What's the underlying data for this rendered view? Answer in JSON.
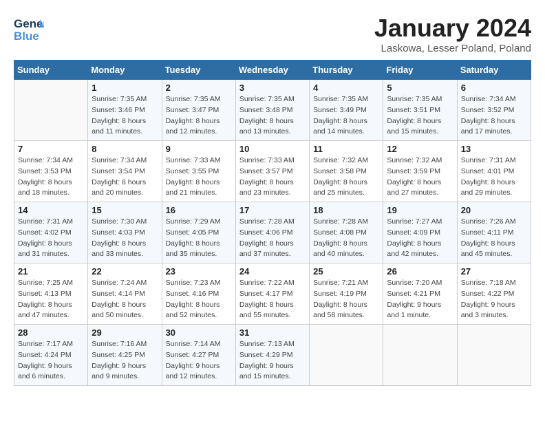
{
  "header": {
    "logo_line1": "General",
    "logo_line2": "Blue",
    "month": "January 2024",
    "location": "Laskowa, Lesser Poland, Poland"
  },
  "weekdays": [
    "Sunday",
    "Monday",
    "Tuesday",
    "Wednesday",
    "Thursday",
    "Friday",
    "Saturday"
  ],
  "weeks": [
    [
      {
        "day": "",
        "sunrise": "",
        "sunset": "",
        "daylight": ""
      },
      {
        "day": "1",
        "sunrise": "Sunrise: 7:35 AM",
        "sunset": "Sunset: 3:46 PM",
        "daylight": "Daylight: 8 hours and 11 minutes."
      },
      {
        "day": "2",
        "sunrise": "Sunrise: 7:35 AM",
        "sunset": "Sunset: 3:47 PM",
        "daylight": "Daylight: 8 hours and 12 minutes."
      },
      {
        "day": "3",
        "sunrise": "Sunrise: 7:35 AM",
        "sunset": "Sunset: 3:48 PM",
        "daylight": "Daylight: 8 hours and 13 minutes."
      },
      {
        "day": "4",
        "sunrise": "Sunrise: 7:35 AM",
        "sunset": "Sunset: 3:49 PM",
        "daylight": "Daylight: 8 hours and 14 minutes."
      },
      {
        "day": "5",
        "sunrise": "Sunrise: 7:35 AM",
        "sunset": "Sunset: 3:51 PM",
        "daylight": "Daylight: 8 hours and 15 minutes."
      },
      {
        "day": "6",
        "sunrise": "Sunrise: 7:34 AM",
        "sunset": "Sunset: 3:52 PM",
        "daylight": "Daylight: 8 hours and 17 minutes."
      }
    ],
    [
      {
        "day": "7",
        "sunrise": "Sunrise: 7:34 AM",
        "sunset": "Sunset: 3:53 PM",
        "daylight": "Daylight: 8 hours and 18 minutes."
      },
      {
        "day": "8",
        "sunrise": "Sunrise: 7:34 AM",
        "sunset": "Sunset: 3:54 PM",
        "daylight": "Daylight: 8 hours and 20 minutes."
      },
      {
        "day": "9",
        "sunrise": "Sunrise: 7:33 AM",
        "sunset": "Sunset: 3:55 PM",
        "daylight": "Daylight: 8 hours and 21 minutes."
      },
      {
        "day": "10",
        "sunrise": "Sunrise: 7:33 AM",
        "sunset": "Sunset: 3:57 PM",
        "daylight": "Daylight: 8 hours and 23 minutes."
      },
      {
        "day": "11",
        "sunrise": "Sunrise: 7:32 AM",
        "sunset": "Sunset: 3:58 PM",
        "daylight": "Daylight: 8 hours and 25 minutes."
      },
      {
        "day": "12",
        "sunrise": "Sunrise: 7:32 AM",
        "sunset": "Sunset: 3:59 PM",
        "daylight": "Daylight: 8 hours and 27 minutes."
      },
      {
        "day": "13",
        "sunrise": "Sunrise: 7:31 AM",
        "sunset": "Sunset: 4:01 PM",
        "daylight": "Daylight: 8 hours and 29 minutes."
      }
    ],
    [
      {
        "day": "14",
        "sunrise": "Sunrise: 7:31 AM",
        "sunset": "Sunset: 4:02 PM",
        "daylight": "Daylight: 8 hours and 31 minutes."
      },
      {
        "day": "15",
        "sunrise": "Sunrise: 7:30 AM",
        "sunset": "Sunset: 4:03 PM",
        "daylight": "Daylight: 8 hours and 33 minutes."
      },
      {
        "day": "16",
        "sunrise": "Sunrise: 7:29 AM",
        "sunset": "Sunset: 4:05 PM",
        "daylight": "Daylight: 8 hours and 35 minutes."
      },
      {
        "day": "17",
        "sunrise": "Sunrise: 7:28 AM",
        "sunset": "Sunset: 4:06 PM",
        "daylight": "Daylight: 8 hours and 37 minutes."
      },
      {
        "day": "18",
        "sunrise": "Sunrise: 7:28 AM",
        "sunset": "Sunset: 4:08 PM",
        "daylight": "Daylight: 8 hours and 40 minutes."
      },
      {
        "day": "19",
        "sunrise": "Sunrise: 7:27 AM",
        "sunset": "Sunset: 4:09 PM",
        "daylight": "Daylight: 8 hours and 42 minutes."
      },
      {
        "day": "20",
        "sunrise": "Sunrise: 7:26 AM",
        "sunset": "Sunset: 4:11 PM",
        "daylight": "Daylight: 8 hours and 45 minutes."
      }
    ],
    [
      {
        "day": "21",
        "sunrise": "Sunrise: 7:25 AM",
        "sunset": "Sunset: 4:13 PM",
        "daylight": "Daylight: 8 hours and 47 minutes."
      },
      {
        "day": "22",
        "sunrise": "Sunrise: 7:24 AM",
        "sunset": "Sunset: 4:14 PM",
        "daylight": "Daylight: 8 hours and 50 minutes."
      },
      {
        "day": "23",
        "sunrise": "Sunrise: 7:23 AM",
        "sunset": "Sunset: 4:16 PM",
        "daylight": "Daylight: 8 hours and 52 minutes."
      },
      {
        "day": "24",
        "sunrise": "Sunrise: 7:22 AM",
        "sunset": "Sunset: 4:17 PM",
        "daylight": "Daylight: 8 hours and 55 minutes."
      },
      {
        "day": "25",
        "sunrise": "Sunrise: 7:21 AM",
        "sunset": "Sunset: 4:19 PM",
        "daylight": "Daylight: 8 hours and 58 minutes."
      },
      {
        "day": "26",
        "sunrise": "Sunrise: 7:20 AM",
        "sunset": "Sunset: 4:21 PM",
        "daylight": "Daylight: 9 hours and 1 minute."
      },
      {
        "day": "27",
        "sunrise": "Sunrise: 7:18 AM",
        "sunset": "Sunset: 4:22 PM",
        "daylight": "Daylight: 9 hours and 3 minutes."
      }
    ],
    [
      {
        "day": "28",
        "sunrise": "Sunrise: 7:17 AM",
        "sunset": "Sunset: 4:24 PM",
        "daylight": "Daylight: 9 hours and 6 minutes."
      },
      {
        "day": "29",
        "sunrise": "Sunrise: 7:16 AM",
        "sunset": "Sunset: 4:25 PM",
        "daylight": "Daylight: 9 hours and 9 minutes."
      },
      {
        "day": "30",
        "sunrise": "Sunrise: 7:14 AM",
        "sunset": "Sunset: 4:27 PM",
        "daylight": "Daylight: 9 hours and 12 minutes."
      },
      {
        "day": "31",
        "sunrise": "Sunrise: 7:13 AM",
        "sunset": "Sunset: 4:29 PM",
        "daylight": "Daylight: 9 hours and 15 minutes."
      },
      {
        "day": "",
        "sunrise": "",
        "sunset": "",
        "daylight": ""
      },
      {
        "day": "",
        "sunrise": "",
        "sunset": "",
        "daylight": ""
      },
      {
        "day": "",
        "sunrise": "",
        "sunset": "",
        "daylight": ""
      }
    ]
  ]
}
